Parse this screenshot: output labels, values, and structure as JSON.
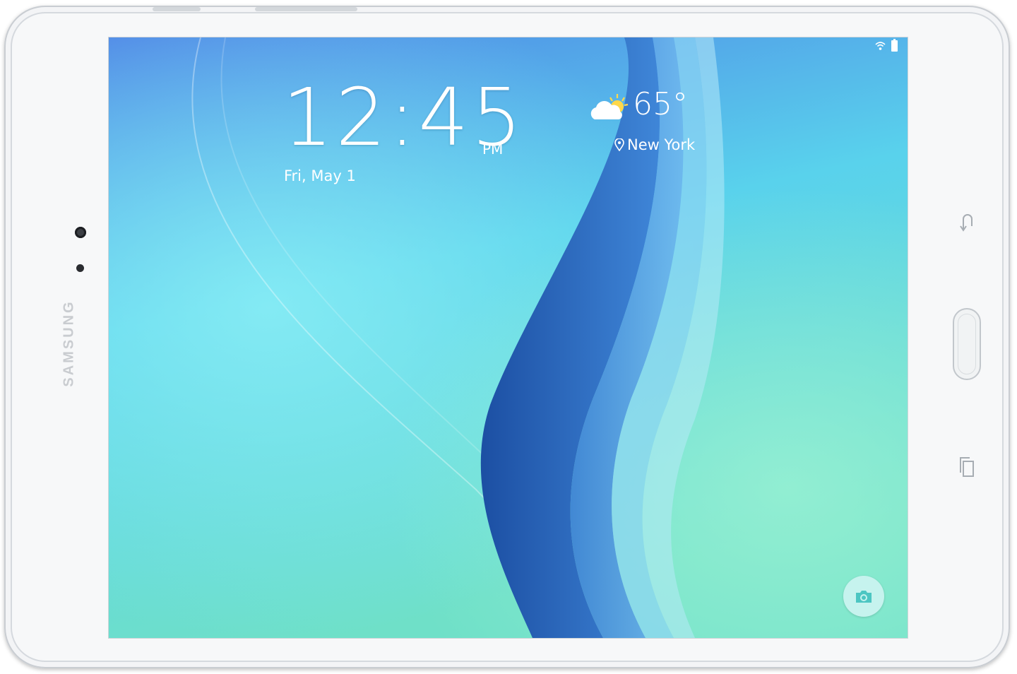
{
  "device": {
    "brand": "SAMSUNG"
  },
  "lockscreen": {
    "time": "12:45",
    "ampm": "PM",
    "date": "Fri, May 1",
    "weather": {
      "temperature": "65°",
      "location": "New York",
      "icon": "partly-cloudy-icon"
    },
    "status_bar": {
      "icons": [
        "wifi-icon",
        "battery-icon"
      ]
    },
    "shortcut": {
      "icon": "camera-icon"
    }
  },
  "hardware_keys": {
    "back": "back-icon",
    "home": "home-button",
    "recent": "recent-apps-icon"
  },
  "colors": {
    "wallpaper_top": "#4f86e6",
    "wallpaper_mid": "#59d2ec",
    "wallpaper_bottom": "#6fe0c8",
    "accent_curve": "#2b63b8",
    "bezel": "#f7f8f9"
  }
}
